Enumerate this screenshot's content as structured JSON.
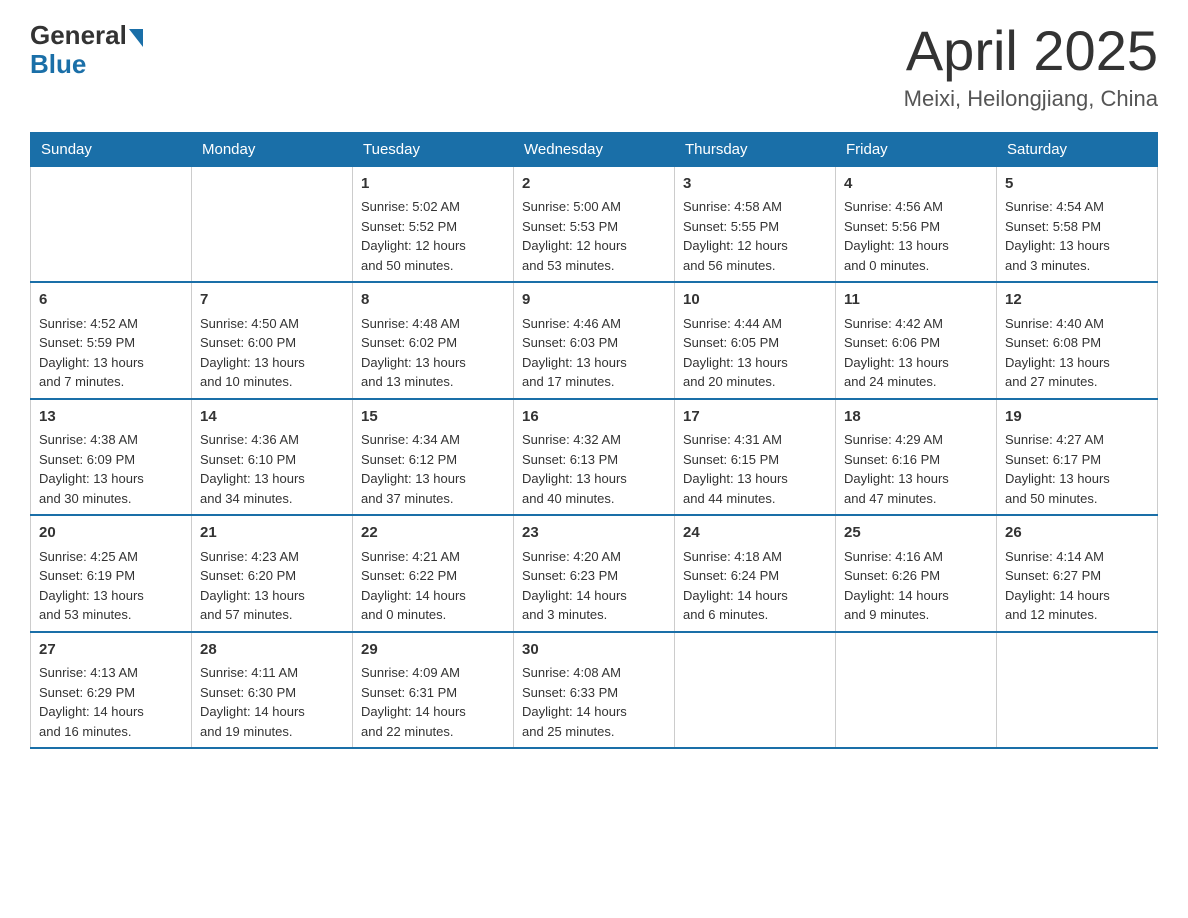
{
  "header": {
    "logo_general": "General",
    "logo_blue": "Blue",
    "month_title": "April 2025",
    "location": "Meixi, Heilongjiang, China"
  },
  "days_of_week": [
    "Sunday",
    "Monday",
    "Tuesday",
    "Wednesday",
    "Thursday",
    "Friday",
    "Saturday"
  ],
  "weeks": [
    [
      {
        "day": "",
        "info": ""
      },
      {
        "day": "",
        "info": ""
      },
      {
        "day": "1",
        "info": "Sunrise: 5:02 AM\nSunset: 5:52 PM\nDaylight: 12 hours\nand 50 minutes."
      },
      {
        "day": "2",
        "info": "Sunrise: 5:00 AM\nSunset: 5:53 PM\nDaylight: 12 hours\nand 53 minutes."
      },
      {
        "day": "3",
        "info": "Sunrise: 4:58 AM\nSunset: 5:55 PM\nDaylight: 12 hours\nand 56 minutes."
      },
      {
        "day": "4",
        "info": "Sunrise: 4:56 AM\nSunset: 5:56 PM\nDaylight: 13 hours\nand 0 minutes."
      },
      {
        "day": "5",
        "info": "Sunrise: 4:54 AM\nSunset: 5:58 PM\nDaylight: 13 hours\nand 3 minutes."
      }
    ],
    [
      {
        "day": "6",
        "info": "Sunrise: 4:52 AM\nSunset: 5:59 PM\nDaylight: 13 hours\nand 7 minutes."
      },
      {
        "day": "7",
        "info": "Sunrise: 4:50 AM\nSunset: 6:00 PM\nDaylight: 13 hours\nand 10 minutes."
      },
      {
        "day": "8",
        "info": "Sunrise: 4:48 AM\nSunset: 6:02 PM\nDaylight: 13 hours\nand 13 minutes."
      },
      {
        "day": "9",
        "info": "Sunrise: 4:46 AM\nSunset: 6:03 PM\nDaylight: 13 hours\nand 17 minutes."
      },
      {
        "day": "10",
        "info": "Sunrise: 4:44 AM\nSunset: 6:05 PM\nDaylight: 13 hours\nand 20 minutes."
      },
      {
        "day": "11",
        "info": "Sunrise: 4:42 AM\nSunset: 6:06 PM\nDaylight: 13 hours\nand 24 minutes."
      },
      {
        "day": "12",
        "info": "Sunrise: 4:40 AM\nSunset: 6:08 PM\nDaylight: 13 hours\nand 27 minutes."
      }
    ],
    [
      {
        "day": "13",
        "info": "Sunrise: 4:38 AM\nSunset: 6:09 PM\nDaylight: 13 hours\nand 30 minutes."
      },
      {
        "day": "14",
        "info": "Sunrise: 4:36 AM\nSunset: 6:10 PM\nDaylight: 13 hours\nand 34 minutes."
      },
      {
        "day": "15",
        "info": "Sunrise: 4:34 AM\nSunset: 6:12 PM\nDaylight: 13 hours\nand 37 minutes."
      },
      {
        "day": "16",
        "info": "Sunrise: 4:32 AM\nSunset: 6:13 PM\nDaylight: 13 hours\nand 40 minutes."
      },
      {
        "day": "17",
        "info": "Sunrise: 4:31 AM\nSunset: 6:15 PM\nDaylight: 13 hours\nand 44 minutes."
      },
      {
        "day": "18",
        "info": "Sunrise: 4:29 AM\nSunset: 6:16 PM\nDaylight: 13 hours\nand 47 minutes."
      },
      {
        "day": "19",
        "info": "Sunrise: 4:27 AM\nSunset: 6:17 PM\nDaylight: 13 hours\nand 50 minutes."
      }
    ],
    [
      {
        "day": "20",
        "info": "Sunrise: 4:25 AM\nSunset: 6:19 PM\nDaylight: 13 hours\nand 53 minutes."
      },
      {
        "day": "21",
        "info": "Sunrise: 4:23 AM\nSunset: 6:20 PM\nDaylight: 13 hours\nand 57 minutes."
      },
      {
        "day": "22",
        "info": "Sunrise: 4:21 AM\nSunset: 6:22 PM\nDaylight: 14 hours\nand 0 minutes."
      },
      {
        "day": "23",
        "info": "Sunrise: 4:20 AM\nSunset: 6:23 PM\nDaylight: 14 hours\nand 3 minutes."
      },
      {
        "day": "24",
        "info": "Sunrise: 4:18 AM\nSunset: 6:24 PM\nDaylight: 14 hours\nand 6 minutes."
      },
      {
        "day": "25",
        "info": "Sunrise: 4:16 AM\nSunset: 6:26 PM\nDaylight: 14 hours\nand 9 minutes."
      },
      {
        "day": "26",
        "info": "Sunrise: 4:14 AM\nSunset: 6:27 PM\nDaylight: 14 hours\nand 12 minutes."
      }
    ],
    [
      {
        "day": "27",
        "info": "Sunrise: 4:13 AM\nSunset: 6:29 PM\nDaylight: 14 hours\nand 16 minutes."
      },
      {
        "day": "28",
        "info": "Sunrise: 4:11 AM\nSunset: 6:30 PM\nDaylight: 14 hours\nand 19 minutes."
      },
      {
        "day": "29",
        "info": "Sunrise: 4:09 AM\nSunset: 6:31 PM\nDaylight: 14 hours\nand 22 minutes."
      },
      {
        "day": "30",
        "info": "Sunrise: 4:08 AM\nSunset: 6:33 PM\nDaylight: 14 hours\nand 25 minutes."
      },
      {
        "day": "",
        "info": ""
      },
      {
        "day": "",
        "info": ""
      },
      {
        "day": "",
        "info": ""
      }
    ]
  ]
}
